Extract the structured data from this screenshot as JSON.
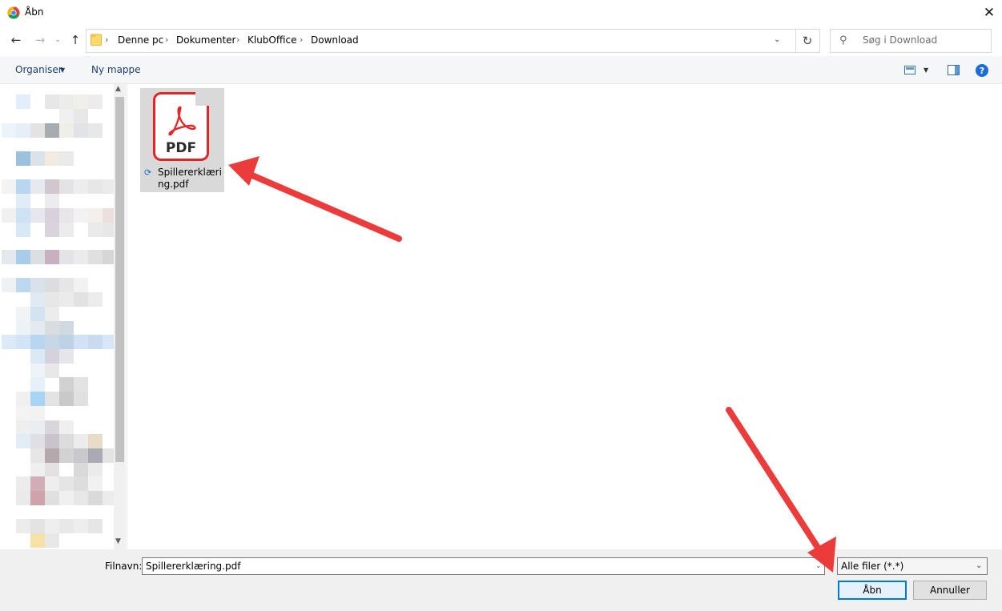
{
  "window": {
    "title": "Åbn"
  },
  "navigation": {
    "breadcrumb": [
      "Denne pc",
      "Dokumenter",
      "KlubOffice",
      "Download"
    ],
    "search_placeholder": "Søg i Download"
  },
  "toolbar": {
    "organize_label": "Organiser",
    "new_folder_label": "Ny mappe"
  },
  "files": [
    {
      "name": "Spillererklæring.pdf",
      "display_name": "Spillererklæring.pdf",
      "icon": "pdf-icon",
      "icon_label": "PDF",
      "selected": true
    }
  ],
  "bottom": {
    "filename_label": "Filnavn:",
    "filename_value": "Spillererklæring.pdf",
    "filetype_value": "Alle filer (*.*)",
    "open_label": "Åbn",
    "cancel_label": "Annuller"
  },
  "colors": {
    "accent": "#0078d7",
    "annotation_arrow": "#ec3b3b",
    "pdf_red": "#e42526"
  }
}
